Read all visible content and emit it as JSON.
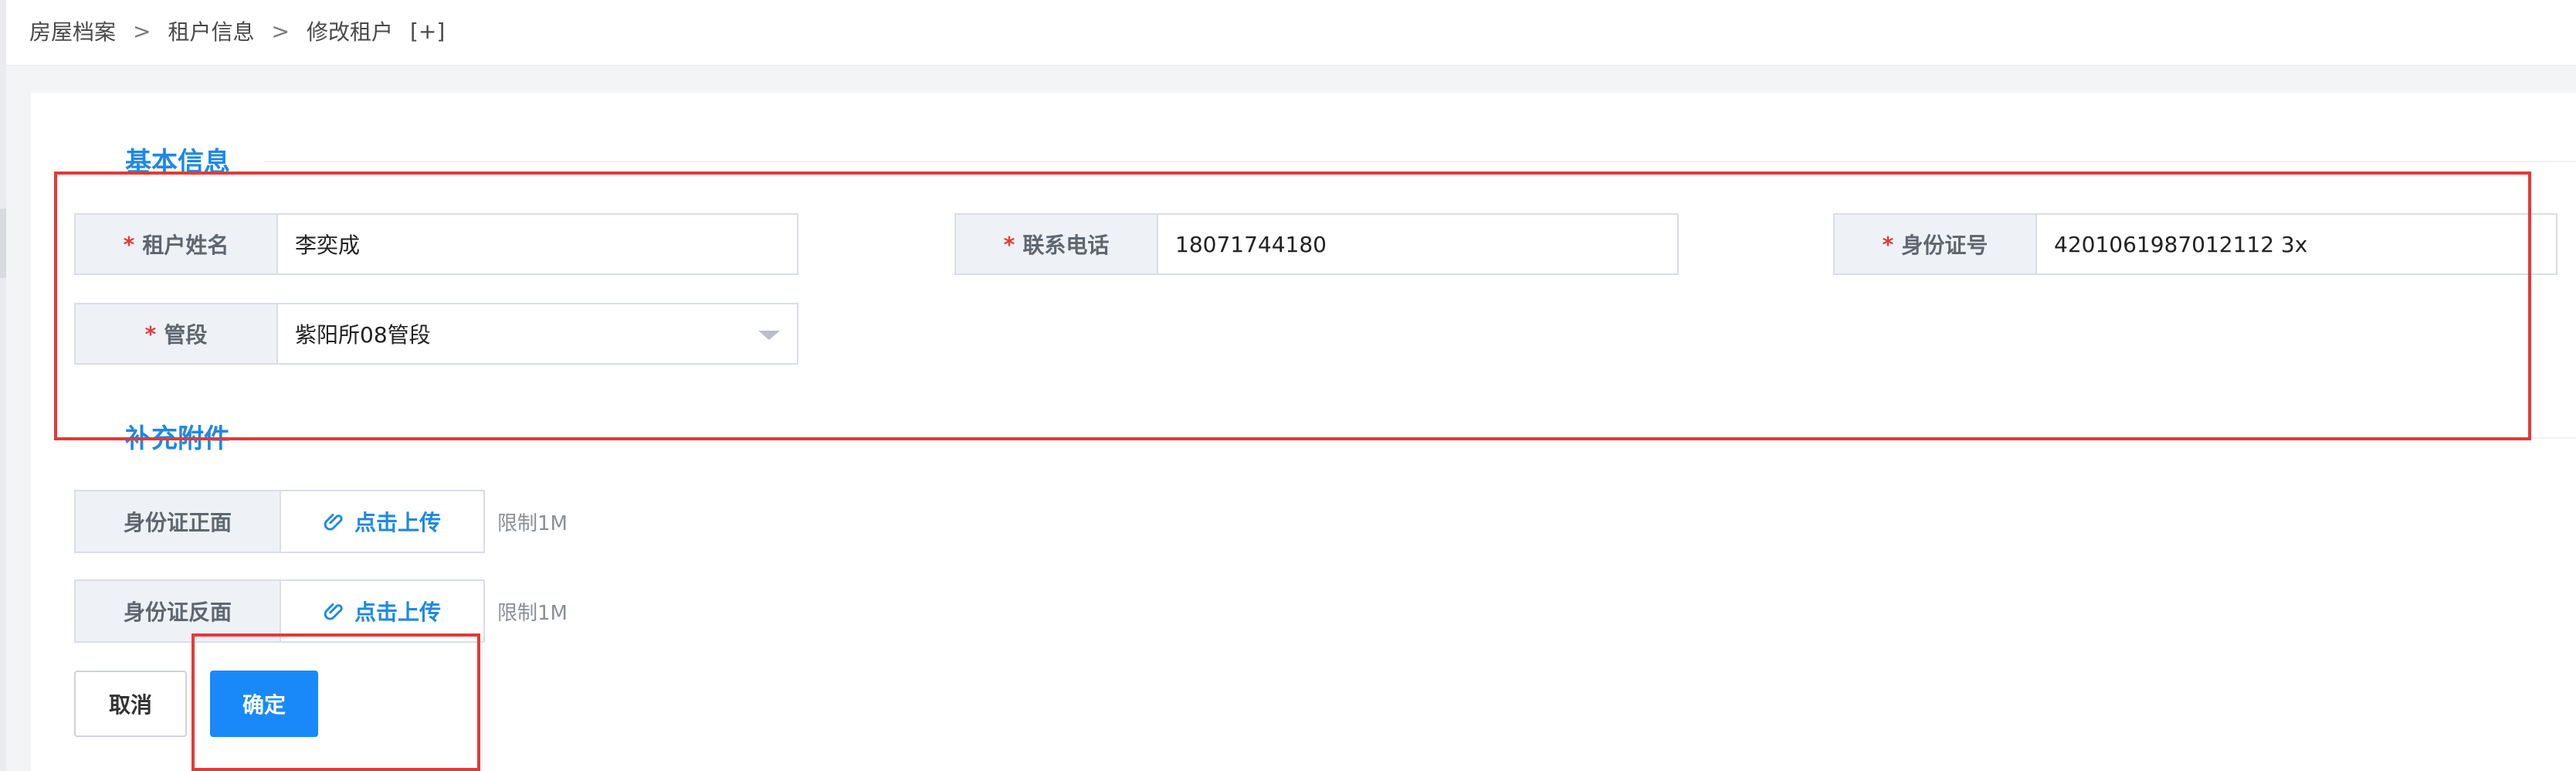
{
  "breadcrumb": {
    "items": [
      "房屋档案",
      "租户信息",
      "修改租户"
    ],
    "separator": ">",
    "add_label": "[+]"
  },
  "sections": {
    "basic_title": "基本信息",
    "attachments_title": "补充附件"
  },
  "form": {
    "required_mark": "*",
    "tenant_name": {
      "label": "租户姓名",
      "value": "李奕成"
    },
    "phone": {
      "label": "联系电话",
      "value": "18071744180"
    },
    "id_number": {
      "label": "身份证号",
      "value": "4201061987012112 3x"
    },
    "district": {
      "label": "管段",
      "value": "紫阳所08管段"
    }
  },
  "attachments": {
    "front": {
      "label": "身份证正面",
      "upload_label": "点击上传",
      "limit": "限制1M"
    },
    "back": {
      "label": "身份证反面",
      "upload_label": "点击上传",
      "limit": "限制1M"
    }
  },
  "actions": {
    "cancel_label": "取消",
    "confirm_label": "确定"
  },
  "colors": {
    "accent": "#1e88e5",
    "primary_button": "#1989fa",
    "required": "#e53935",
    "highlight": "#e53935"
  },
  "icons": {
    "upload": "paperclip-icon",
    "select": "chevron-down-icon"
  }
}
